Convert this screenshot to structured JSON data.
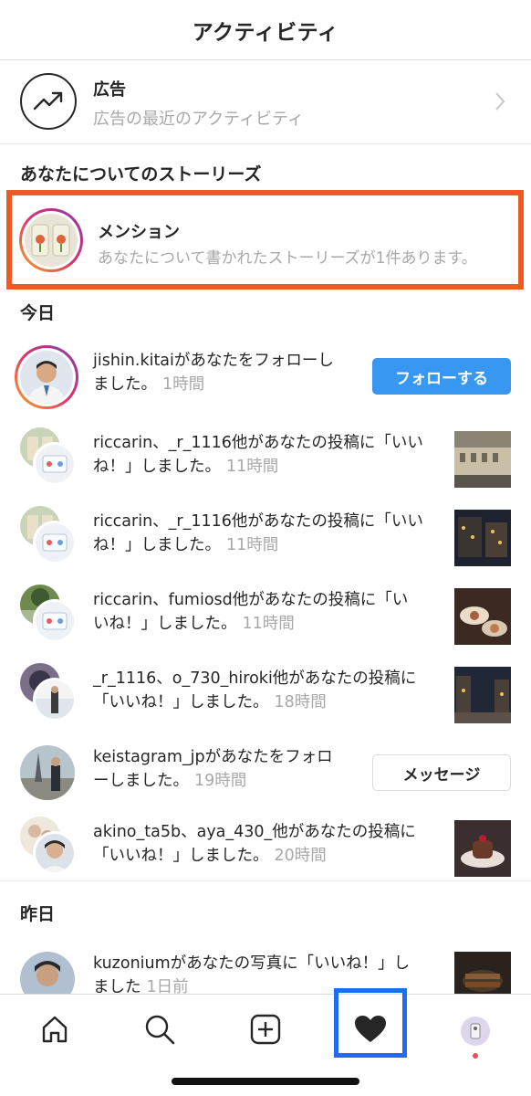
{
  "header": {
    "title": "アクティビティ"
  },
  "ads": {
    "title": "広告",
    "subtitle": "広告の最近のアクティビティ",
    "icon": "trending-up-icon"
  },
  "stories_section": {
    "title": "あなたについてのストーリーズ"
  },
  "mention": {
    "title": "メンション",
    "subtitle": "あなたについて書かれたストーリーズが1件あります。"
  },
  "today": {
    "title": "今日",
    "items": [
      {
        "line1": "jishin.kitaiがあなたをフォローし",
        "line2": "ました。",
        "time": "1時間",
        "action": "フォローする"
      },
      {
        "line1": "riccarin、_r_1116他があなたの投稿に「いい",
        "line2": "ね！」しました。",
        "time": "11時間"
      },
      {
        "line1": "riccarin、_r_1116他があなたの投稿に「いい",
        "line2": "ね！」しました。",
        "time": "11時間"
      },
      {
        "line1": "riccarin、fumiosd他があなたの投稿に「い",
        "line2": "いね！」しました。",
        "time": "11時間"
      },
      {
        "line1": "_r_1116、o_730_hiroki他があなたの投稿に",
        "line2": "「いいね！」しました。",
        "time": "18時間"
      },
      {
        "line1": "keistagram_jpがあなたをフォロ",
        "line2": "ーしました。",
        "time": "19時間",
        "action": "メッセージ"
      },
      {
        "line1": "akino_ta5b、aya_430_他があなたの投稿に",
        "line2": "「いいね！」しました。",
        "time": "20時間"
      }
    ]
  },
  "yesterday": {
    "title": "昨日",
    "items": [
      {
        "line1": "kuzoniumがあなたの写真に「いいね！」し",
        "line2": "ました",
        "time": "1日前"
      }
    ]
  },
  "tabbar": {
    "tabs": [
      "home-icon",
      "search-icon",
      "add-post-icon",
      "heart-icon",
      "profile-avatar"
    ],
    "active": "heart-icon",
    "accent": "#1e6cf2"
  },
  "colors": {
    "follow_button": "#3897f0",
    "mention_highlight": "#ef5a24",
    "secondary_text": "#a8a8a8"
  }
}
